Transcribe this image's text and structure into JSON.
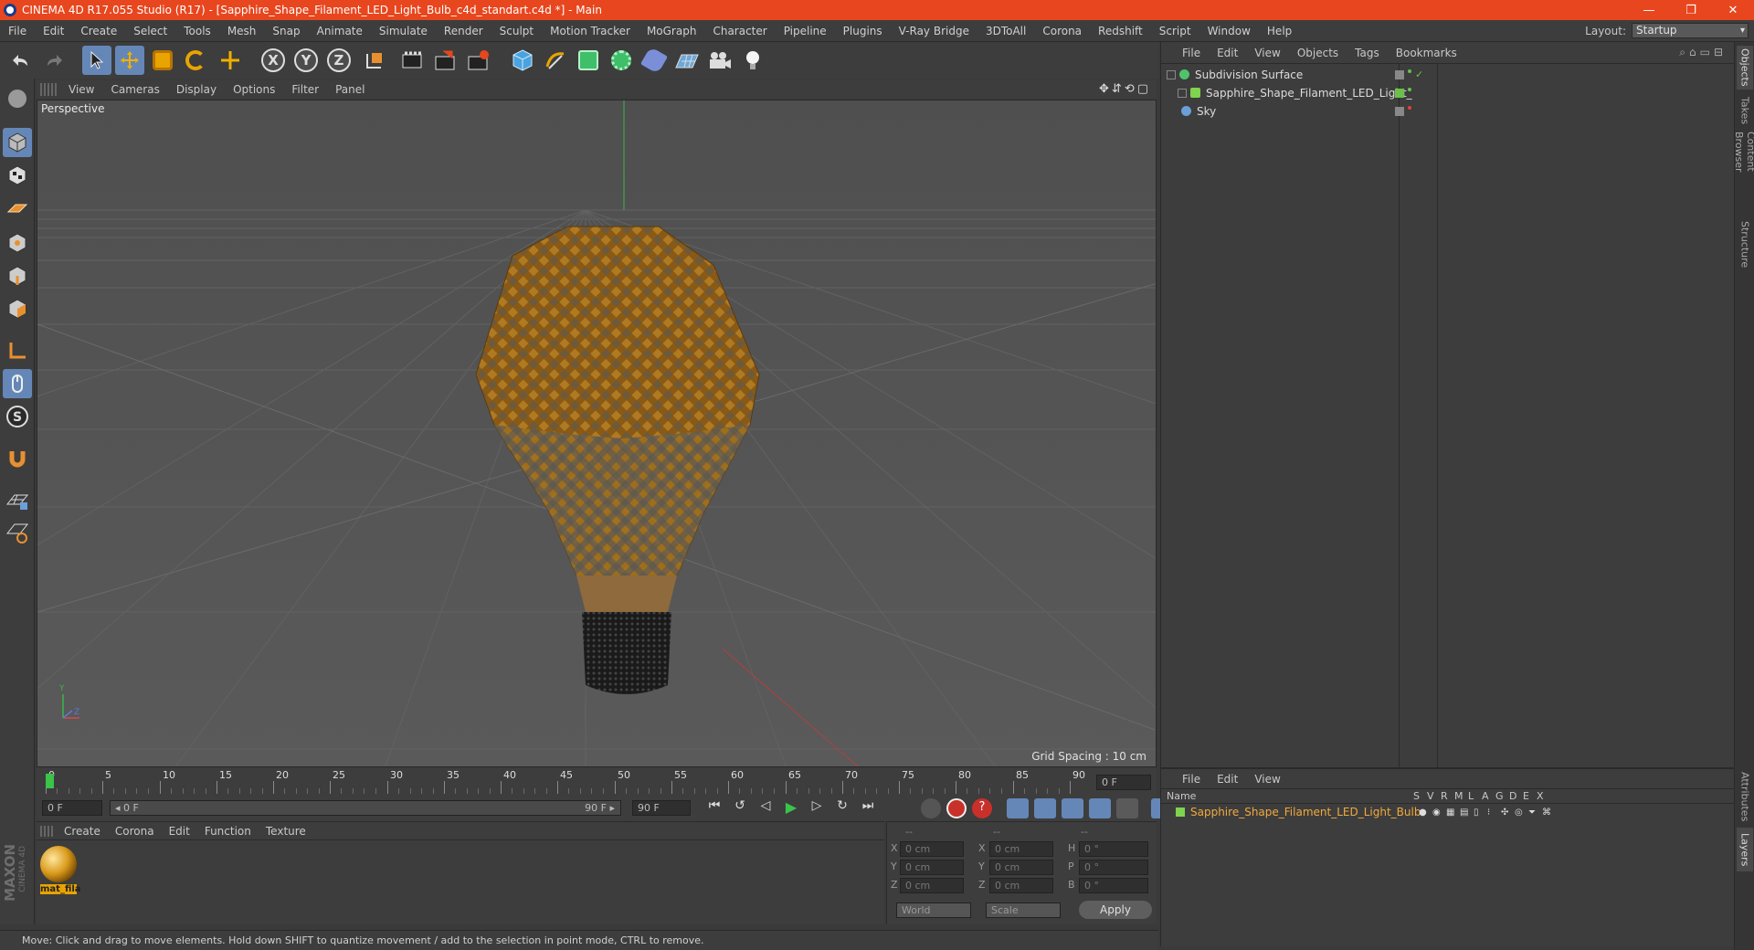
{
  "window": {
    "title": "CINEMA 4D R17.055 Studio (R17) - [Sapphire_Shape_Filament_LED_Light_Bulb_c4d_standart.c4d *] - Main",
    "minimize": "—",
    "restore": "❐",
    "close": "✕"
  },
  "menubar": {
    "items": [
      "File",
      "Edit",
      "Create",
      "Select",
      "Tools",
      "Mesh",
      "Snap",
      "Animate",
      "Simulate",
      "Render",
      "Sculpt",
      "Motion Tracker",
      "MoGraph",
      "Character",
      "Pipeline",
      "Plugins",
      "V-Ray Bridge",
      "3DToAll",
      "Corona",
      "Redshift",
      "Script",
      "Window",
      "Help"
    ],
    "layout_label": "Layout:",
    "layout_value": "Startup"
  },
  "toolbar": {
    "axis_x": "X",
    "axis_y": "Y",
    "axis_z": "Z"
  },
  "viewport": {
    "menu": [
      "View",
      "Cameras",
      "Display",
      "Options",
      "Filter",
      "Panel"
    ],
    "label": "Perspective",
    "grid_spacing": "Grid Spacing : 10 cm",
    "nav_icons": "✥⇵⟲▢"
  },
  "timeline": {
    "ticks": [
      "0",
      "5",
      "10",
      "15",
      "20",
      "25",
      "30",
      "35",
      "40",
      "45",
      "50",
      "55",
      "60",
      "65",
      "70",
      "75",
      "80",
      "85",
      "90"
    ],
    "current_frame": "0 F",
    "start_frame": "0 F",
    "range_start": "◂ 0 F",
    "range_end": "90 F ▸",
    "end_frame": "90 F"
  },
  "materials": {
    "menu": [
      "Create",
      "Corona",
      "Edit",
      "Function",
      "Texture"
    ],
    "items": [
      {
        "name": "mat_fila"
      }
    ]
  },
  "coords": {
    "headers": [
      "--",
      "--",
      "--"
    ],
    "rows": [
      {
        "a": "X",
        "av": "0 cm",
        "b": "X",
        "bv": "0 cm",
        "c": "H",
        "cv": "0 °"
      },
      {
        "a": "Y",
        "av": "0 cm",
        "b": "Y",
        "bv": "0 cm",
        "c": "P",
        "cv": "0 °"
      },
      {
        "a": "Z",
        "av": "0 cm",
        "b": "Z",
        "bv": "0 cm",
        "c": "B",
        "cv": "0 °"
      }
    ],
    "world": "World",
    "scale": "Scale",
    "apply": "Apply"
  },
  "objects": {
    "menu": [
      "File",
      "Edit",
      "View",
      "Objects",
      "Tags",
      "Bookmarks"
    ],
    "rows": [
      {
        "name": "Subdivision Surface",
        "color": "#4fc36b"
      },
      {
        "name": "Sapphire_Shape_Filament_LED_Light_Bulb",
        "color": "#7fd34e"
      },
      {
        "name": "Sky",
        "color": "#6a9fd8"
      }
    ]
  },
  "layers": {
    "menu": [
      "File",
      "Edit",
      "View"
    ],
    "col_name": "Name",
    "cols": [
      "S",
      "V",
      "R",
      "M",
      "L",
      "A",
      "G",
      "D",
      "E",
      "X"
    ],
    "rows": [
      {
        "name": "Sapphire_Shape_Filament_LED_Light_Bulb",
        "color": "#7fd34e"
      }
    ]
  },
  "sidetabs": [
    "Objects",
    "Takes",
    "Content Browser",
    "Structure",
    "Attributes",
    "Layers"
  ],
  "status": "Move: Click and drag to move elements. Hold down SHIFT to quantize movement / add to the selection in point mode, CTRL to remove.",
  "branding": {
    "maxon": "MAXON",
    "c4d": "CINEMA 4D"
  },
  "colors": {
    "accent": "#e8461e",
    "selection": "#6587b8",
    "layer_text": "#f2a93b"
  }
}
